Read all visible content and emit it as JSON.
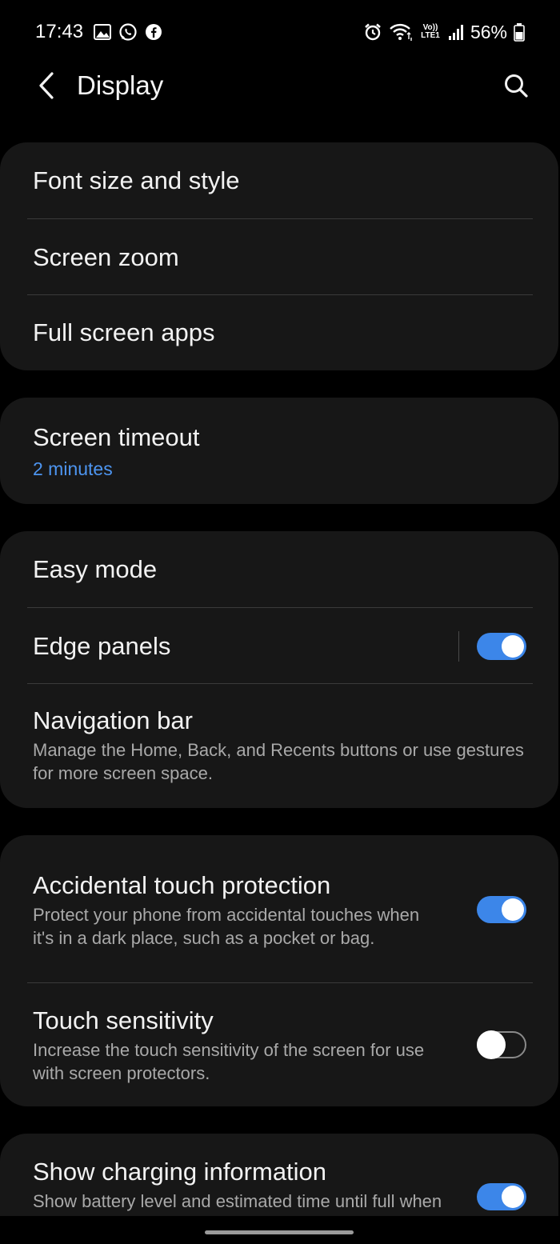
{
  "status_bar": {
    "time": "17:43",
    "battery_percent": "56%",
    "left_icons": [
      "gallery-icon",
      "whatsapp-icon",
      "facebook-icon"
    ],
    "right_icons": [
      "alarm-icon",
      "wifi-icon",
      "volte-icon",
      "signal-icon",
      "battery-icon"
    ],
    "volte_label_top": "Vo))",
    "volte_label_bottom": "LTE1"
  },
  "header": {
    "title": "Display"
  },
  "sections": {
    "font_size_and_style": "Font size and style",
    "screen_zoom": "Screen zoom",
    "full_screen_apps": "Full screen apps",
    "screen_timeout": {
      "title": "Screen timeout",
      "value": "2 minutes"
    },
    "easy_mode": "Easy mode",
    "edge_panels": {
      "title": "Edge panels",
      "enabled": true
    },
    "navigation_bar": {
      "title": "Navigation bar",
      "subtitle": "Manage the Home, Back, and Recents buttons or use gestures for more screen space."
    },
    "accidental_touch": {
      "title": "Accidental touch protection",
      "subtitle": "Protect your phone from accidental touches when it's in a dark place, such as a pocket or bag.",
      "enabled": true
    },
    "touch_sensitivity": {
      "title": "Touch sensitivity",
      "subtitle": "Increase the touch sensitivity of the screen for use with screen protectors.",
      "enabled": false
    },
    "show_charging": {
      "title": "Show charging information",
      "subtitle": "Show battery level and estimated time until full when Always On Display is off or not shown.",
      "enabled": true
    }
  },
  "colors": {
    "accent": "#3c86e9",
    "value_text": "#4d95f0",
    "card_bg": "#171717",
    "background": "#000000"
  }
}
